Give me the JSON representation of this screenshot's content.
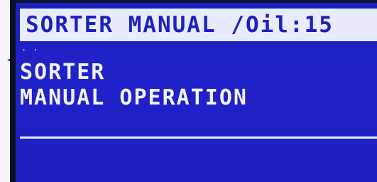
{
  "header": {
    "title": "SORTER MANUAL /Oil:15"
  },
  "indicator": {
    "dots": ". ."
  },
  "content": {
    "line1": "SORTER",
    "line2": "MANUAL OPERATION"
  },
  "icons": {
    "pointer": "arrow-pointer-icon"
  },
  "colors": {
    "screen": "#1d1fbf",
    "text": "#f1f3ff",
    "header_bg": "#e9ecff"
  }
}
